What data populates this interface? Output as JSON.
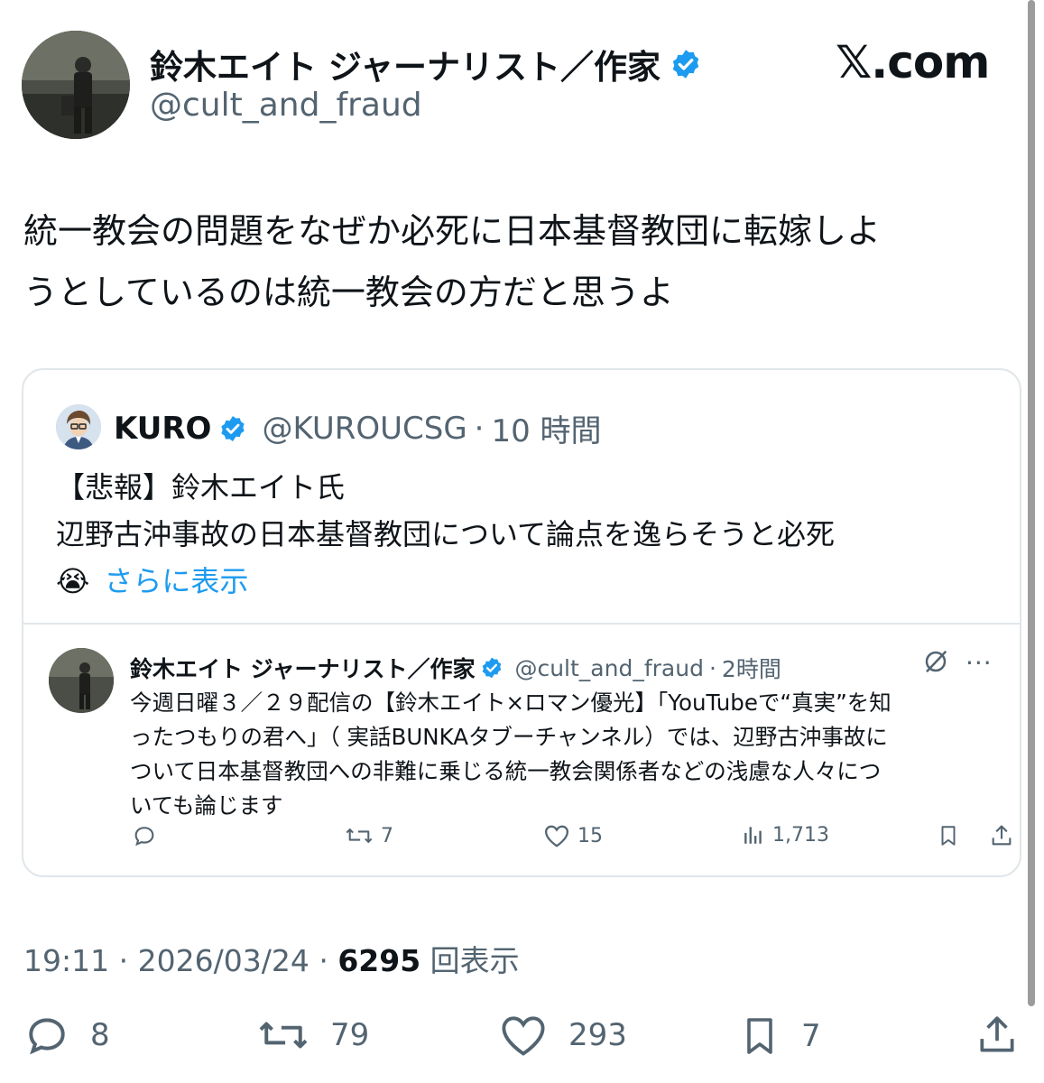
{
  "author": {
    "display_name": "鈴木エイト ジャーナリスト／作家",
    "handle": "@cult_and_fraud",
    "verified_icon": "verified-badge-icon",
    "accent": "#1d9bf0"
  },
  "brand": {
    "label": "𝕏.com"
  },
  "tweet": {
    "line1": "統一教会の問題をなぜか必死に日本基督教団に転嫁しよ",
    "line2": "うとしているのは統一教会の方だと思うよ"
  },
  "quote": {
    "name": "KURO",
    "handle": "@KUROUCSG",
    "separator": "·",
    "time": "10 時間",
    "line1": "【悲報】鈴木エイト氏",
    "line2": "辺野古沖事故の日本基督教団について論点を逸らそうと必死",
    "emoji": "😭",
    "show_more": "さらに表示",
    "inner": {
      "name": "鈴木エイト ジャーナリスト／作家",
      "handle": "@cult_and_fraud",
      "separator": "·",
      "time": "2時間",
      "line1": "今週日曜３／２９配信の【鈴木エイト×ロマン優光】「YouTubeで“真実”を知",
      "line2": "ったつもりの君へ」（ 実話BUNKAタブーチャンネル）では、辺野古沖事故に",
      "line3": "ついて日本基督教団への非難に乗じる統一教会関係者などの浅慮な人々につ",
      "line4": "いても論じます",
      "retweets": "7",
      "likes": "15",
      "views": "1,713"
    }
  },
  "meta": {
    "time": "19:11",
    "separator": "·",
    "date": "2026/03/24",
    "views_count": "6295",
    "views_label": "回表示"
  },
  "actions": {
    "replies": "8",
    "retweets": "79",
    "likes": "293",
    "bookmarks": "7"
  }
}
